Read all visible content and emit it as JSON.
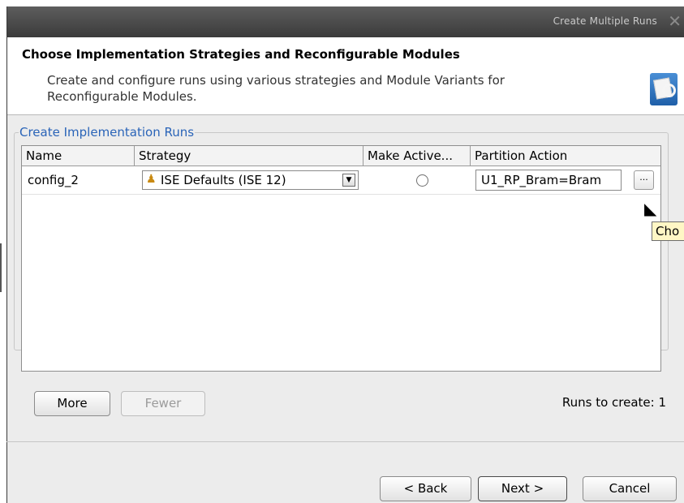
{
  "window": {
    "title": "Create Multiple Runs"
  },
  "header": {
    "title": "Choose Implementation Strategies and Reconfigurable Modules",
    "description": "Create and configure runs using various strategies and Module Variants for Reconfigurable Modules."
  },
  "group": {
    "legend": "Create Implementation Runs"
  },
  "table": {
    "columns": [
      "Name",
      "Strategy",
      "Make Active...",
      "Partition Action"
    ],
    "rows": [
      {
        "name": "config_2",
        "strategy": "ISE Defaults (ISE 12)",
        "make_active": false,
        "partition_action": "U1_RP_Bram=Bram"
      }
    ],
    "ellipsis_label": "..."
  },
  "tooltip": {
    "text": "Cho"
  },
  "buttons": {
    "more": "More",
    "fewer": "Fewer",
    "back": "< Back",
    "next": "Next >",
    "cancel": "Cancel"
  },
  "runs_to_create": "Runs to create: 1",
  "icons": {
    "strategy": "strategy-person-icon",
    "dropdown": "chevron-down-icon",
    "header": "document-search-icon",
    "close": "close-icon"
  },
  "colors": {
    "accent": "#2a64b8",
    "titlebar": "#444444",
    "tooltip_bg": "#fff7c5"
  }
}
